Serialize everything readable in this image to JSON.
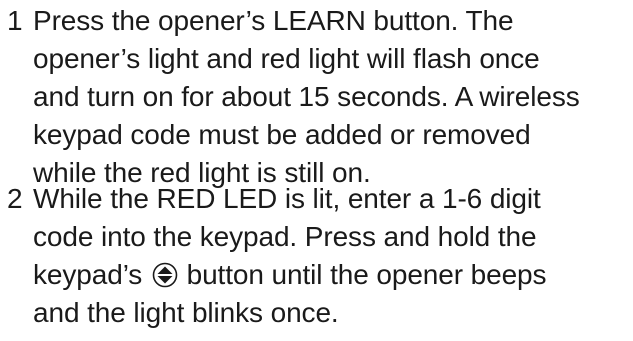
{
  "steps": [
    {
      "number": "1",
      "lines": [
        "Press the opener’s LEARN button. The",
        "opener’s light and red light will flash once",
        "and turn on for about 15 seconds. A wireless",
        "keypad code must be added or removed",
        "while the red light is still on."
      ]
    },
    {
      "number": "2",
      "lines": [
        "While the RED LED is lit, enter a 1-6 digit",
        "code into the keypad. Press and hold the",
        "keypad’s",
        "button until the opener beeps",
        "and the light blinks once."
      ],
      "icon": "keypad-enter-icon"
    }
  ]
}
